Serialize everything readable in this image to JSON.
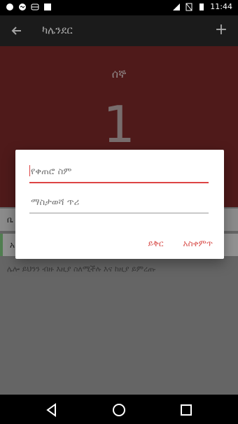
{
  "status": {
    "time": "11:44"
  },
  "toolbar": {
    "title": "ካሌንደር",
    "add_symbol": "+"
  },
  "hero": {
    "day_name": "ሰኞ",
    "day_number": "1"
  },
  "list": {
    "row1_text": "ቤ",
    "row2_text": "አ",
    "row3_text": "ሌሎ ይህንን ብዙ እዚያ ስለሚችሉ እና ከዚያ ይምረጡ"
  },
  "dialog": {
    "name_placeholder": "የቀጠሮ ስም",
    "note_placeholder": "ማስታወሻ ጥሪ",
    "cancel_label": "ይቅር",
    "continue_label": "አስቀምጥ"
  },
  "colors": {
    "accent": "#d9534f",
    "hero_bg": "#7a2929"
  }
}
